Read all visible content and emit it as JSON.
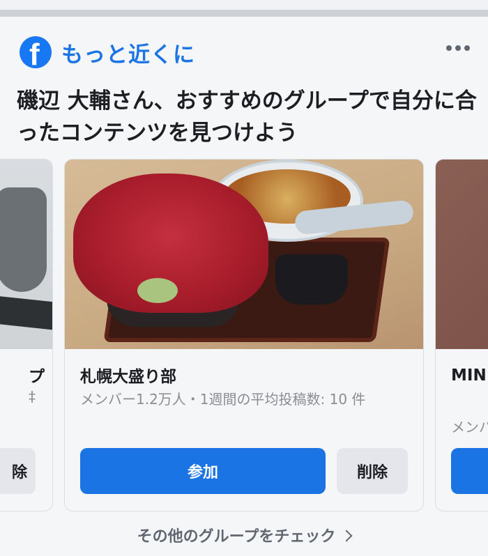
{
  "header": {
    "logo_letter": "f",
    "title": "もっと近くに",
    "brand_color": "#1877f2"
  },
  "headline": "磯辺 大輔さん、おすすめのグループで自分に合ったコンテンツを見つけよう",
  "cards": {
    "left": {
      "name": "プ",
      "meta": "‡",
      "remove_label": "除"
    },
    "center": {
      "name": "札幌大盛り部",
      "meta": "メンバー1.2万人・1週間の平均投稿数: 10 件",
      "join_label": "参加",
      "remove_label": "削除"
    },
    "right": {
      "name": "MIN FAN",
      "meta": "メンバ"
    }
  },
  "footer": {
    "link_label": "その他のグループをチェック"
  },
  "colors": {
    "join_button": "#1b74e4",
    "remove_button": "#e4e6eb"
  }
}
